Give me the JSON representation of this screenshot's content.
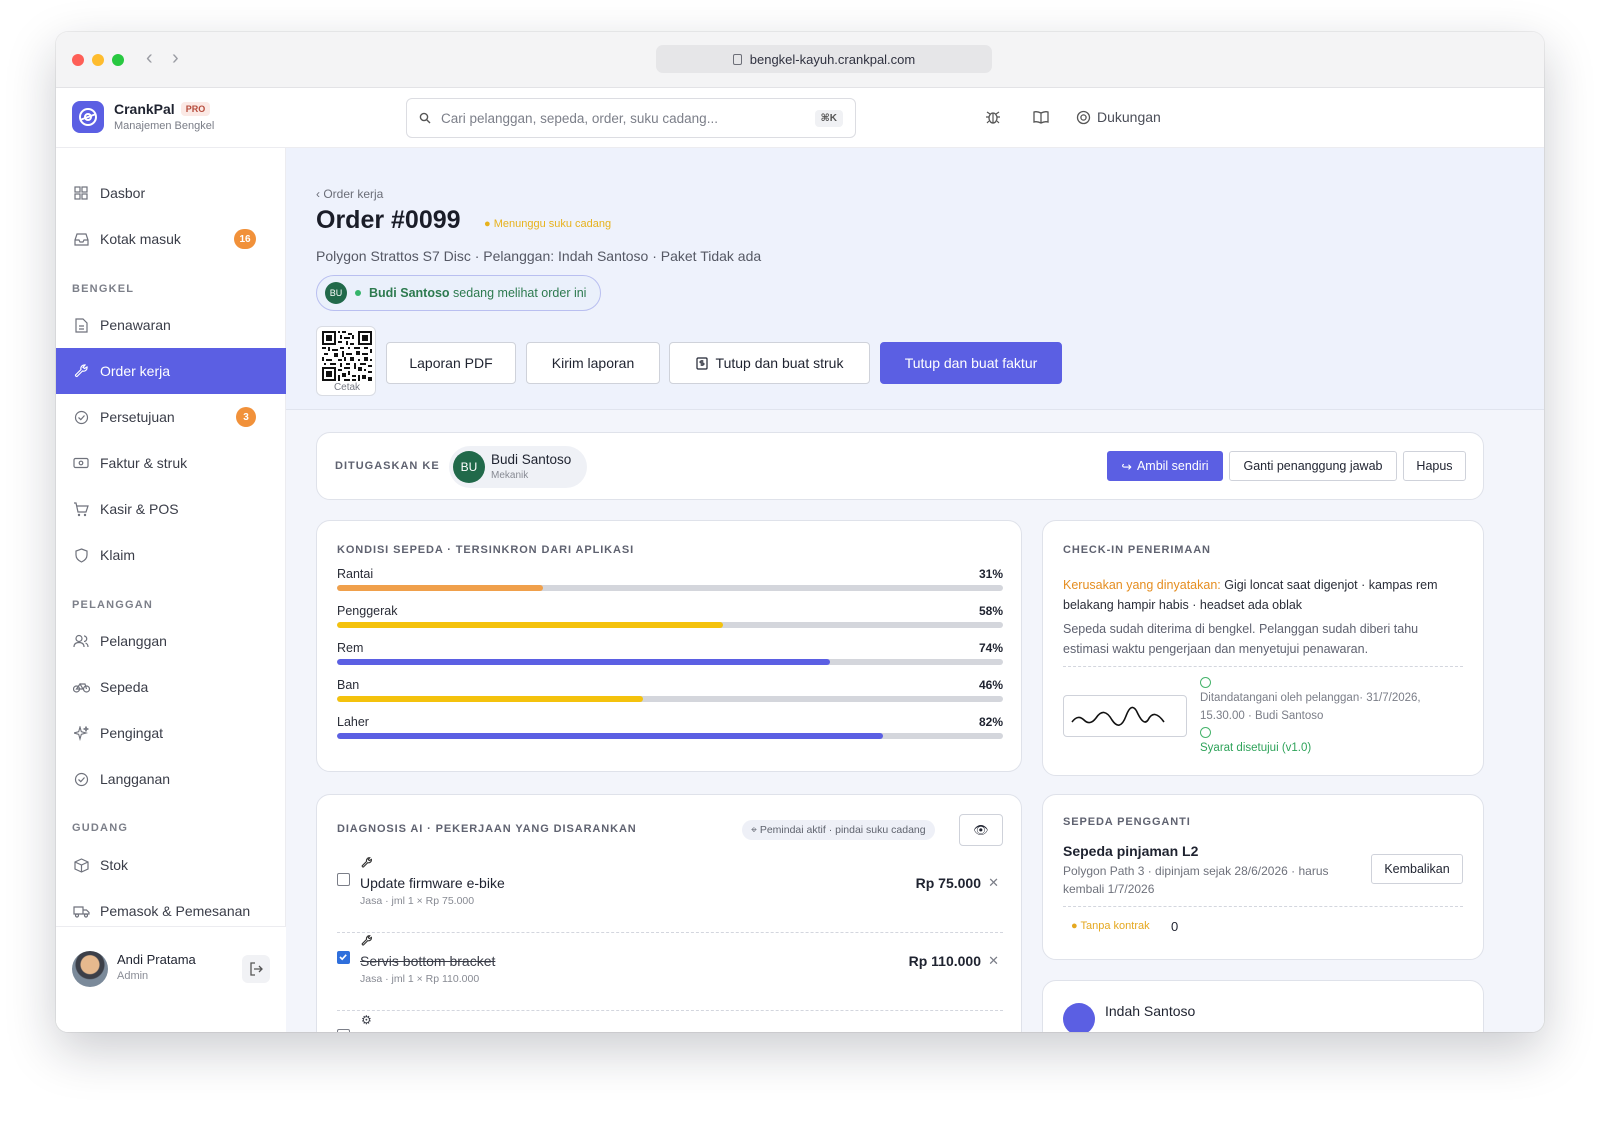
{
  "browser": {
    "url": "bengkel-kayuh.crankpal.com"
  },
  "brand": {
    "name": "CrankPal",
    "tier": "PRO",
    "subtitle": "Manajemen Bengkel"
  },
  "search": {
    "placeholder": "Cari pelanggan, sepeda, order, suku cadang...",
    "shortcut": "⌘K"
  },
  "header": {
    "support_label": "Dukungan"
  },
  "sidebar": {
    "top_items": [
      {
        "label": "Dasbor",
        "icon": "grid-icon"
      },
      {
        "label": "Kotak masuk",
        "icon": "inbox-icon",
        "badge": "16"
      }
    ],
    "sections": [
      {
        "title": "BENGKEL",
        "items": [
          {
            "label": "Penawaran",
            "icon": "document-icon"
          },
          {
            "label": "Order kerja",
            "icon": "wrench-icon",
            "active": true
          },
          {
            "label": "Persetujuan",
            "icon": "check-circle-icon",
            "badge": "3"
          },
          {
            "label": "Faktur & struk",
            "icon": "receipt-icon"
          },
          {
            "label": "Kasir & POS",
            "icon": "cart-icon"
          },
          {
            "label": "Klaim",
            "icon": "shield-icon"
          }
        ]
      },
      {
        "title": "PELANGGAN",
        "items": [
          {
            "label": "Pelanggan",
            "icon": "users-icon"
          },
          {
            "label": "Sepeda",
            "icon": "bicycle-icon"
          },
          {
            "label": "Pengingat",
            "icon": "sparkle-icon"
          },
          {
            "label": "Langganan",
            "icon": "check-circle-icon"
          }
        ]
      },
      {
        "title": "GUDANG",
        "items": [
          {
            "label": "Stok",
            "icon": "box-icon"
          },
          {
            "label": "Pemasok & Pemesanan",
            "icon": "truck-icon"
          }
        ]
      }
    ],
    "user": {
      "name": "Andi Pratama",
      "role": "Admin"
    }
  },
  "order": {
    "breadcrumb": "‹ Order kerja",
    "title": "Order #0099",
    "status": "Menunggu suku cadang",
    "subtitle": "Polygon Strattos S7 Disc · Pelanggan: Indah Santoso · Paket Tidak ada",
    "viewer": {
      "initials": "BU",
      "name": "Budi Santoso",
      "text": "sedang melihat order ini"
    },
    "qr_caption": "Cetak",
    "actions": {
      "pdf": "Laporan PDF",
      "send": "Kirim laporan",
      "close_receipt": "Tutup dan buat struk",
      "close_invoice": "Tutup dan buat faktur"
    }
  },
  "assignment": {
    "label": "DITUGASKAN KE",
    "initials": "BU",
    "name": "Budi Santoso",
    "role": "Mekanik",
    "take": "Ambil sendiri",
    "change": "Ganti penanggung jawab",
    "remove": "Hapus"
  },
  "condition": {
    "title": "KONDISI SEPEDA · TERSINKRON DARI APLIKASI",
    "items": [
      {
        "label": "Rantai",
        "value": "31%",
        "pct": 31,
        "color": "#f0a04b"
      },
      {
        "label": "Penggerak",
        "value": "58%",
        "pct": 58,
        "color": "#f4c20d"
      },
      {
        "label": "Rem",
        "value": "74%",
        "pct": 74,
        "color": "#5b5fe3"
      },
      {
        "label": "Ban",
        "value": "46%",
        "pct": 46,
        "color": "#f4c20d"
      },
      {
        "label": "Laher",
        "value": "82%",
        "pct": 82,
        "color": "#5b5fe3"
      }
    ]
  },
  "checkin": {
    "title": "CHECK-IN PENERIMAAN",
    "damage_label": "Kerusakan yang dinyatakan:",
    "damage_text": "Gigi loncat saat digenjot · kampas rem belakang hampir habis · headset ada oblak",
    "note": "Sepeda sudah diterima di bengkel. Pelanggan sudah diberi tahu estimasi waktu pengerjaan dan menyetujui penawaran.",
    "signed_line1": "Ditandatangani oleh pelanggan· 31/7/2026,",
    "signed_line2": "15.30.00 · Budi Santoso",
    "terms": "Syarat disetujui (v1.0)"
  },
  "diagnosis": {
    "title": "DIAGNOSIS AI · PEKERJAAN YANG DISARANKAN",
    "scanner": "⌖ Pemindai aktif · pindai suku cadang",
    "eye": "👁",
    "items": [
      {
        "name": "Update firmware e-bike",
        "meta": "Jasa · jml 1 × Rp 75.000",
        "price": "Rp 75.000",
        "checked": false
      },
      {
        "name": "Servis bottom bracket",
        "meta": "Jasa · jml 1 × Rp 110.000",
        "price": "Rp 110.000",
        "checked": true
      }
    ]
  },
  "loaner": {
    "title": "SEPEDA PENGGANTI",
    "name": "Sepeda pinjaman L2",
    "meta": "Polygon Path 3 · dipinjam sejak 28/6/2026 · harus kembali 1/7/2026",
    "return": "Kembalikan",
    "contract": "Tanpa kontrak",
    "count": "0"
  },
  "customer": {
    "name": "Indah Santoso"
  }
}
